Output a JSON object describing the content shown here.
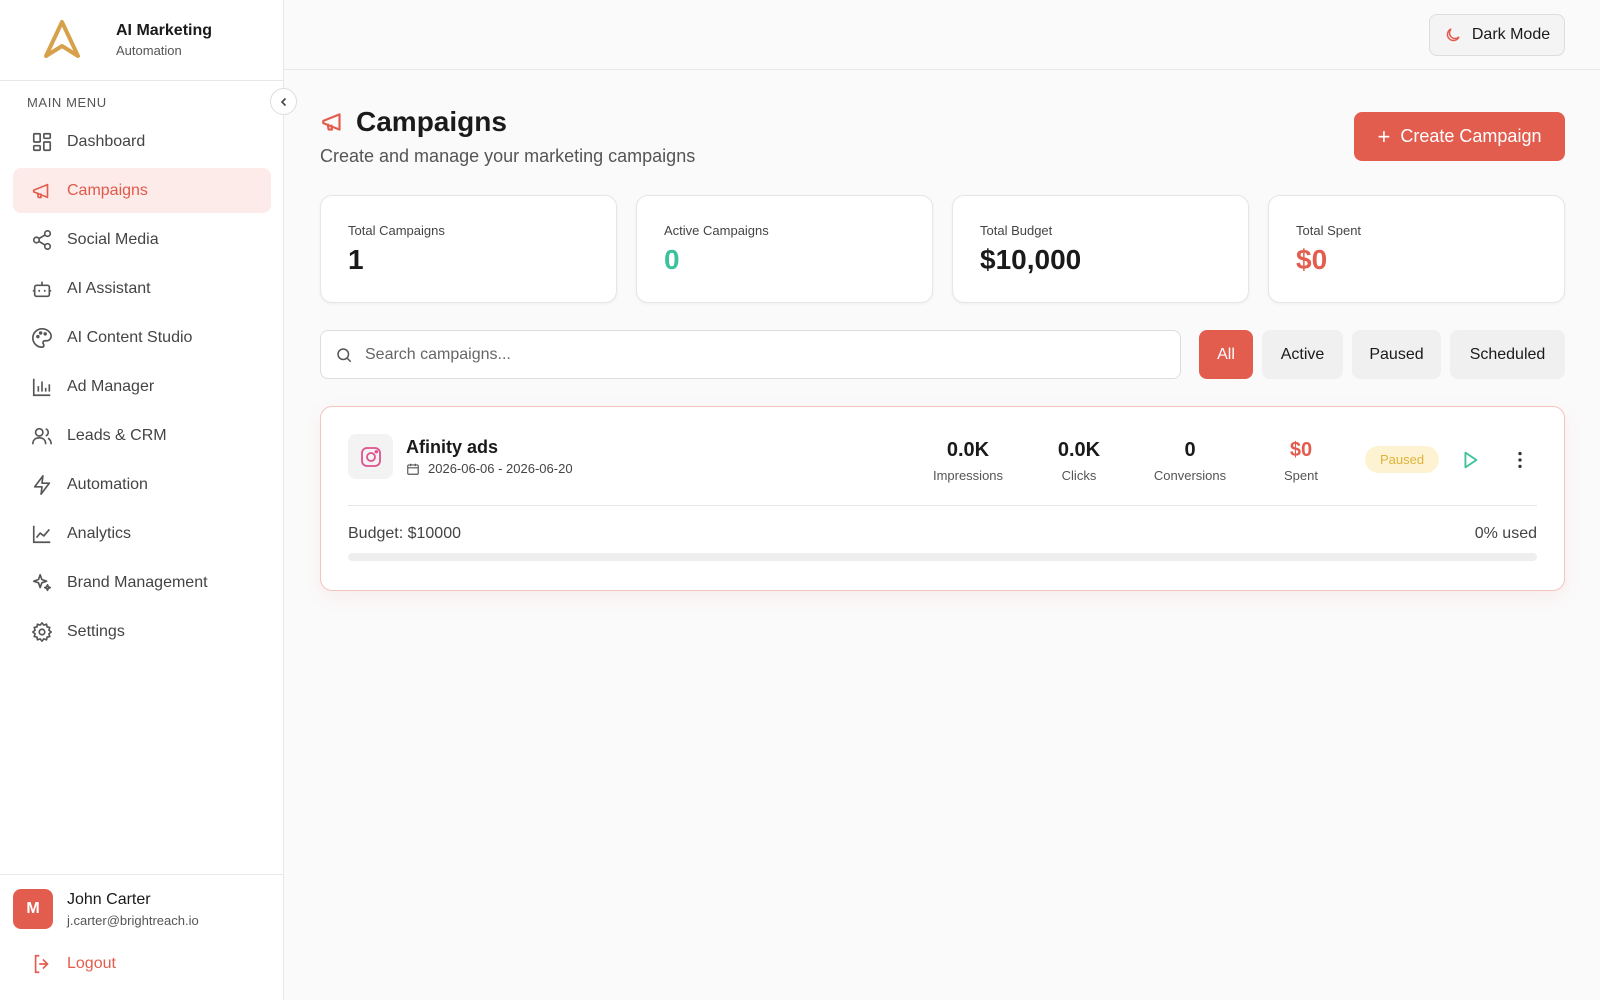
{
  "brand": {
    "title": "AI Marketing",
    "subtitle": "Automation",
    "logo_icon": "triangle-logo-icon"
  },
  "sidebar": {
    "menu_label": "MAIN MENU",
    "items": [
      {
        "label": "Dashboard",
        "icon": "dashboard-icon",
        "active": false
      },
      {
        "label": "Campaigns",
        "icon": "megaphone-icon",
        "active": true
      },
      {
        "label": "Social Media",
        "icon": "share-icon",
        "active": false
      },
      {
        "label": "AI Assistant",
        "icon": "bot-icon",
        "active": false
      },
      {
        "label": "AI Content Studio",
        "icon": "palette-icon",
        "active": false
      },
      {
        "label": "Ad Manager",
        "icon": "bar-chart-icon",
        "active": false
      },
      {
        "label": "Leads & CRM",
        "icon": "users-icon",
        "active": false
      },
      {
        "label": "Automation",
        "icon": "lightning-icon",
        "active": false
      },
      {
        "label": "Analytics",
        "icon": "line-chart-icon",
        "active": false
      },
      {
        "label": "Brand Management",
        "icon": "sparkles-icon",
        "active": false
      },
      {
        "label": "Settings",
        "icon": "gear-icon",
        "active": false
      }
    ],
    "user": {
      "initial": "M",
      "name": "John Carter",
      "email": "j.carter@brightreach.io"
    },
    "logout_label": "Logout"
  },
  "topbar": {
    "dark_mode_label": "Dark Mode"
  },
  "page": {
    "title": "Campaigns",
    "subtitle": "Create and manage your marketing campaigns",
    "create_button_label": "Create Campaign"
  },
  "stats": [
    {
      "label": "Total Campaigns",
      "value": "1",
      "color": "#1a1a1a"
    },
    {
      "label": "Active Campaigns",
      "value": "0",
      "color": "#3cc29b"
    },
    {
      "label": "Total Budget",
      "value": "$10,000",
      "color": "#1a1a1a"
    },
    {
      "label": "Total Spent",
      "value": "$0",
      "color": "#e35d4f"
    }
  ],
  "search": {
    "placeholder": "Search campaigns...",
    "value": ""
  },
  "filters": [
    {
      "label": "All",
      "active": true
    },
    {
      "label": "Active",
      "active": false
    },
    {
      "label": "Paused",
      "active": false
    },
    {
      "label": "Scheduled",
      "active": false
    }
  ],
  "campaigns": [
    {
      "name": "Afinity ads",
      "platform_icon": "instagram-icon",
      "dates": "2026-06-06 - 2026-06-20",
      "metrics": [
        {
          "value": "0.0K",
          "label": "Impressions"
        },
        {
          "value": "0.0K",
          "label": "Clicks"
        },
        {
          "value": "0",
          "label": "Conversions"
        },
        {
          "value": "$0",
          "label": "Spent"
        }
      ],
      "status": "Paused",
      "budget_text": "Budget: $10000",
      "used_text": "0% used",
      "used_fraction": 0
    }
  ],
  "colors": {
    "accent": "#e35d4f",
    "success": "#3cc29b",
    "warning": "#e0b23a"
  }
}
